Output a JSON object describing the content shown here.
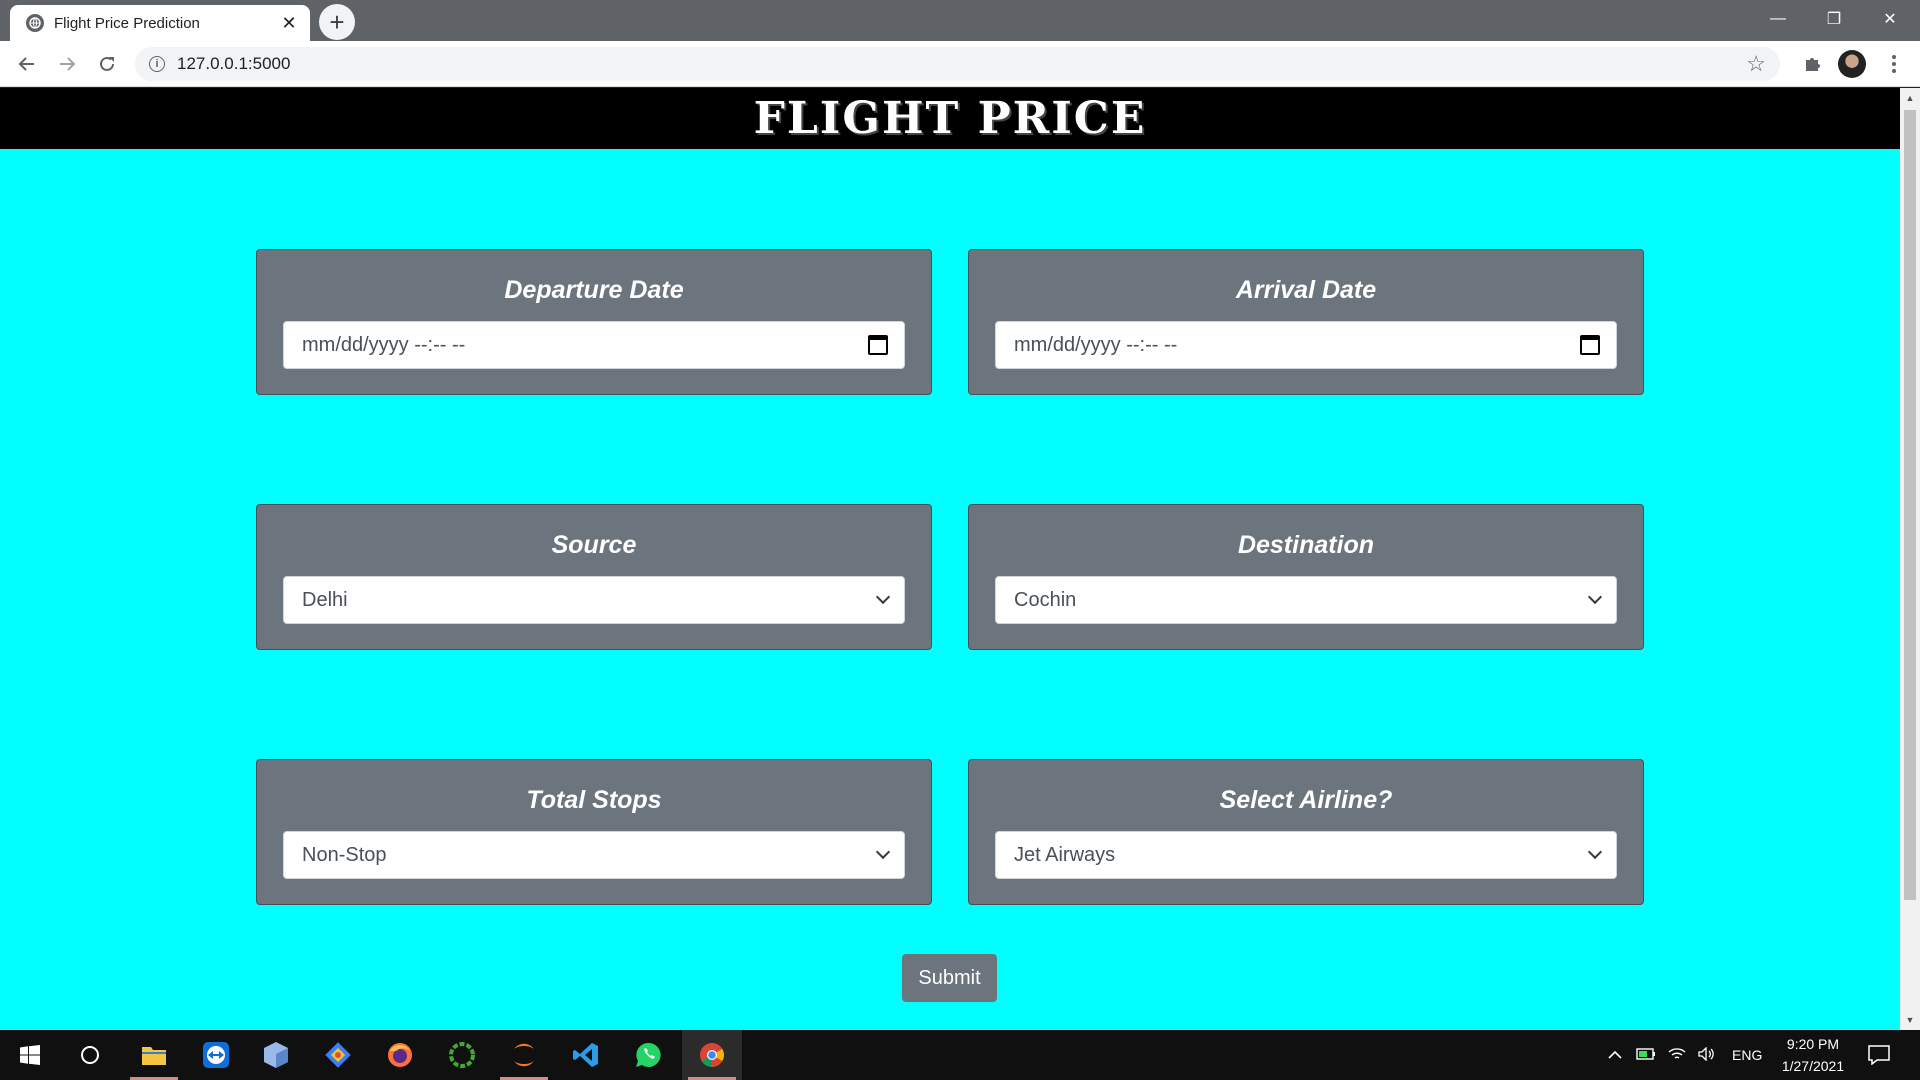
{
  "browser": {
    "tab_title": "Flight Price Prediction",
    "tab_close": "✕",
    "new_tab": "+",
    "url": "127.0.0.1:5000",
    "window_controls": {
      "minimize": "—",
      "restore": "❐",
      "close": "✕"
    }
  },
  "page": {
    "title": "FLIGHT PRICE",
    "background_color": "#00ffff",
    "fields": {
      "departure": {
        "label": "Departure Date",
        "value": "mm/dd/yyyy --:-- --"
      },
      "arrival": {
        "label": "Arrival Date",
        "value": "mm/dd/yyyy --:-- --"
      },
      "source": {
        "label": "Source",
        "selected": "Delhi"
      },
      "destination": {
        "label": "Destination",
        "selected": "Cochin"
      },
      "stops": {
        "label": "Total Stops",
        "selected": "Non-Stop"
      },
      "airline": {
        "label": "Select Airline?",
        "selected": "Jet Airways"
      }
    },
    "submit_label": "Submit"
  },
  "taskbar": {
    "apps": [
      "windows-start",
      "cortana-search",
      "file-explorer",
      "teamviewer",
      "virtualbox",
      "git",
      "firefox",
      "anaconda",
      "jupyter",
      "vscode",
      "whatsapp",
      "chrome"
    ],
    "tray_language": "ENG",
    "time": "9:20 PM",
    "date": "1/27/2021"
  }
}
